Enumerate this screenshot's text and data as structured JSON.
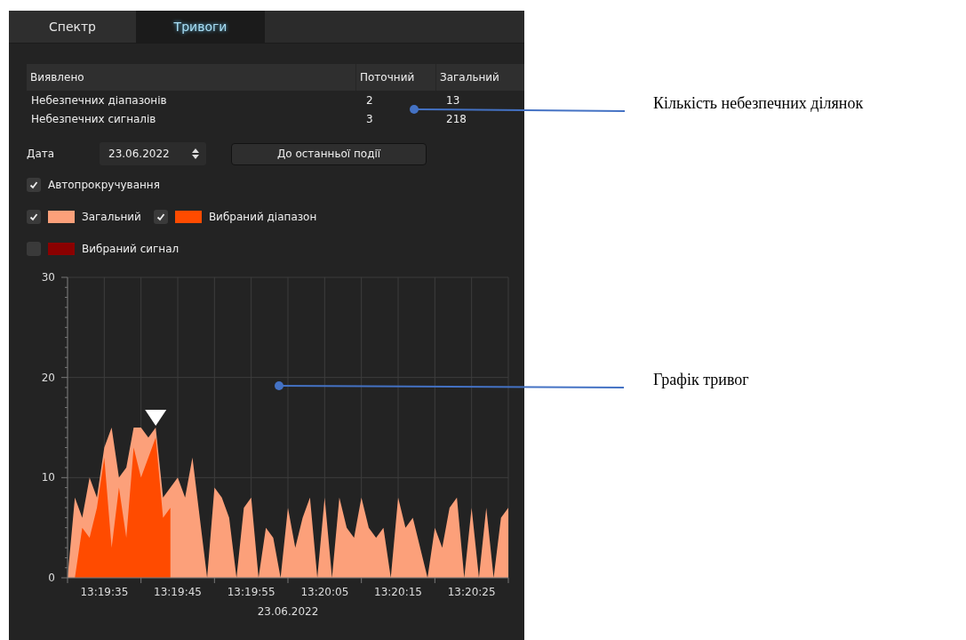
{
  "tabs": [
    {
      "label": "Спектр",
      "selected": false
    },
    {
      "label": "Тривоги",
      "selected": true
    }
  ],
  "detected_table": {
    "columns": [
      "Виявлено",
      "Поточний",
      "Загальний"
    ],
    "rows": [
      {
        "cells": [
          "Небезпечних діапазонів",
          "2",
          "13"
        ]
      },
      {
        "cells": [
          "Небезпечних сигналів",
          "3",
          "218"
        ]
      }
    ]
  },
  "date": {
    "label": "Дата",
    "value": "23.06.2022"
  },
  "last_event_button": "До останньої події",
  "autoscroll": {
    "label": "Автопрокручування",
    "checked": true
  },
  "legend": [
    {
      "label": "Загальний",
      "checked": true,
      "color": "#fca07a"
    },
    {
      "label": "Вибраний діапазон",
      "checked": true,
      "color": "#ff4b00"
    },
    {
      "label": "Вибраний сигнал",
      "checked": false,
      "color": "#8b0000"
    }
  ],
  "chart": {
    "chart_data": {
      "type": "area",
      "xlabel": "23.06.2022",
      "ylim": [
        0,
        30
      ],
      "categories": [
        null,
        null,
        null,
        null,
        null,
        "13:19:35",
        null,
        null,
        null,
        null,
        null,
        null,
        null,
        null,
        null,
        "13:19:45",
        null,
        null,
        null,
        null,
        null,
        null,
        null,
        null,
        null,
        "13:19:55",
        null,
        null,
        null,
        null,
        null,
        null,
        null,
        null,
        null,
        "13:20:05",
        null,
        null,
        null,
        null,
        null,
        null,
        null,
        null,
        null,
        "13:20:15",
        null,
        null,
        null,
        null,
        null,
        null,
        null,
        null,
        null,
        "13:20:25",
        null,
        null,
        null,
        null,
        null
      ],
      "yticks": [
        0,
        10,
        20,
        30
      ],
      "series": [
        {
          "color": "#fca07a",
          "values": [
            0,
            8,
            6,
            10,
            8,
            13,
            15,
            10,
            11,
            15,
            15,
            14,
            15,
            8,
            9,
            10,
            8,
            12,
            6,
            0,
            9,
            8,
            6,
            0,
            7,
            8,
            0,
            5,
            4,
            0,
            7,
            3,
            6,
            8,
            0,
            8,
            0,
            8,
            5,
            4,
            8,
            5,
            4,
            5,
            0,
            8,
            5,
            6,
            3,
            0,
            5,
            3,
            7,
            8,
            0,
            7,
            0,
            7,
            0,
            6,
            7
          ]
        },
        {
          "color": "#ff4b00",
          "values": [
            null,
            0,
            5,
            4,
            7,
            12,
            3,
            9,
            4,
            13,
            10,
            12,
            14,
            6,
            7,
            null,
            null,
            null,
            null,
            null,
            null,
            null,
            null,
            null,
            null,
            null,
            null,
            null,
            null,
            null,
            null,
            null,
            null,
            null,
            null,
            null,
            null,
            null,
            null,
            null,
            null,
            null,
            null,
            null,
            null,
            null,
            null,
            null,
            null,
            null,
            null,
            null,
            null,
            null,
            null,
            null,
            null,
            null,
            null,
            null,
            null
          ]
        }
      ],
      "grid": true
    }
  },
  "callouts": [
    {
      "text": "Кількість небезпечних ділянок"
    },
    {
      "text": "Графік тривог"
    }
  ]
}
